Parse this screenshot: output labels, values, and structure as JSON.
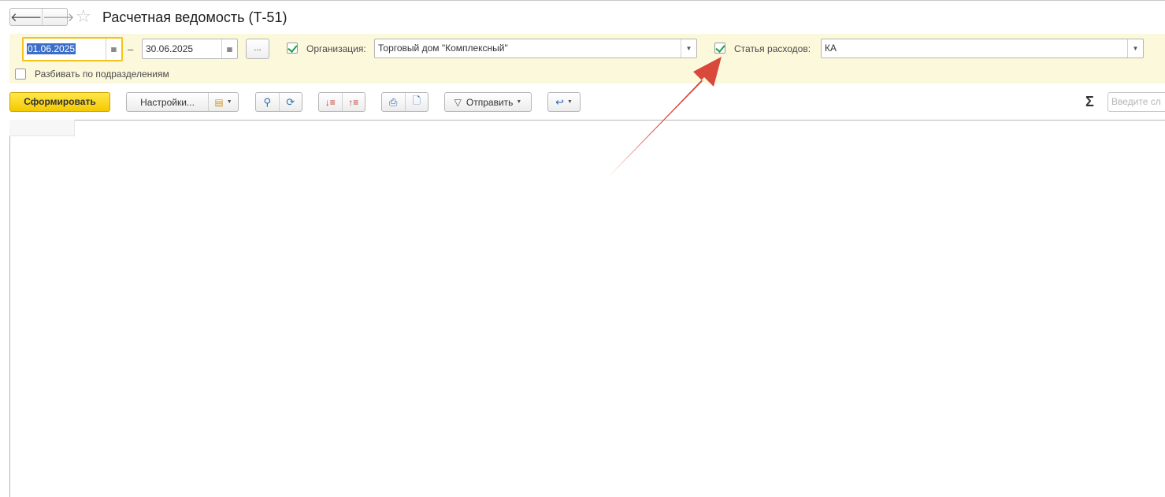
{
  "window": {
    "title": "Расчетная ведомость (Т-51)",
    "back_icon": "arrow-left-icon",
    "forward_icon": "arrow-right-icon",
    "favorite_icon": "star-icon"
  },
  "filters": {
    "date_from": "01.06.2025",
    "date_to": "30.06.2025",
    "date_separator": "–",
    "period_button": "...",
    "organization": {
      "checked": true,
      "label": "Организация:",
      "value": "Торговый дом \"Комплексный\""
    },
    "expense_item": {
      "checked": true,
      "label": "Статья расходов:",
      "value": "КА"
    },
    "split_by_department": {
      "checked": false,
      "label": "Разбивать по подразделениям"
    }
  },
  "toolbar": {
    "generate_label": "Сформировать",
    "settings_label": "Настройки...",
    "send_label": "Отправить",
    "sum_symbol": "Σ",
    "search_placeholder": "Введите сл"
  },
  "colors": {
    "accent_yellow": "#f4c900",
    "panel_bg": "#fcf8dc",
    "annotation_arrow": "#d9493b",
    "checkbox_green": "#1f9e4b"
  }
}
